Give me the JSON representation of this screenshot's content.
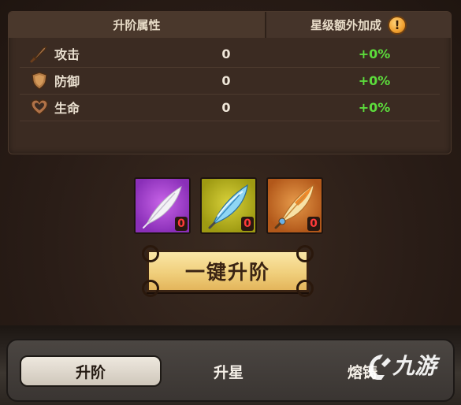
{
  "panel": {
    "header_left": "升阶属性",
    "header_right": "星级额外加成",
    "warn_glyph": "!",
    "rows": [
      {
        "icon": "sword-icon",
        "name": "攻击",
        "value": "0",
        "bonus": "+0%"
      },
      {
        "icon": "shield-icon",
        "name": "防御",
        "value": "0",
        "bonus": "+0%"
      },
      {
        "icon": "heart-icon",
        "name": "生命",
        "value": "0",
        "bonus": "+0%"
      }
    ]
  },
  "materials": [
    {
      "icon": "white-feather-icon",
      "rarity_color": "#9a3ec8",
      "count": "0"
    },
    {
      "icon": "blue-feather-icon",
      "rarity_color": "#b9b31f",
      "count": "0"
    },
    {
      "icon": "golden-feather-icon",
      "rarity_color": "#c46a25",
      "count": "0"
    }
  ],
  "main_button": {
    "label": "一键升阶"
  },
  "tabs": [
    {
      "label": "升阶",
      "active": true
    },
    {
      "label": "升星",
      "active": false
    },
    {
      "label": "熔铸",
      "active": false
    }
  ],
  "colors": {
    "bonus_green": "#5cdc3c",
    "count_red": "#ff3a3a",
    "button_gold": "#f0cf7c"
  }
}
